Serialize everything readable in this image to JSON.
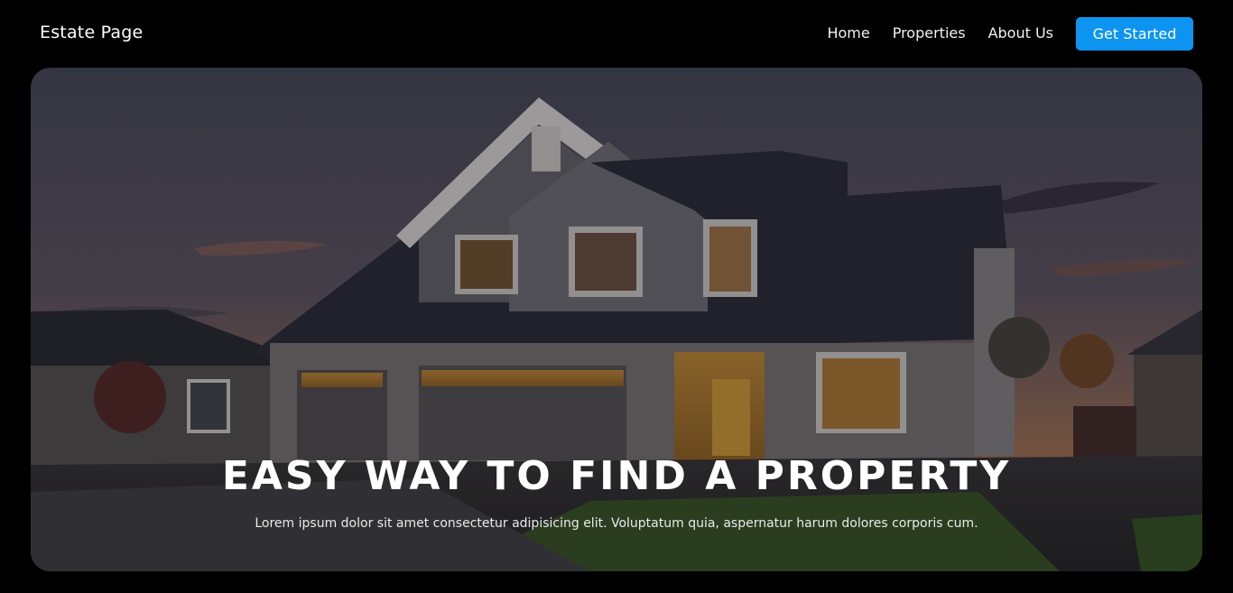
{
  "nav": {
    "brand": "Estate Page",
    "links": [
      {
        "label": "Home"
      },
      {
        "label": "Properties"
      },
      {
        "label": "About Us"
      }
    ],
    "cta_label": "Get Started"
  },
  "hero": {
    "title": "EASY WAY TO FIND A PROPERTY",
    "subtitle": "Lorem ipsum dolor sit amet consectetur adipisicing elit. Voluptatum quia, aspernatur harum dolores corporis cum.",
    "accent_color": "#0d94f1"
  }
}
